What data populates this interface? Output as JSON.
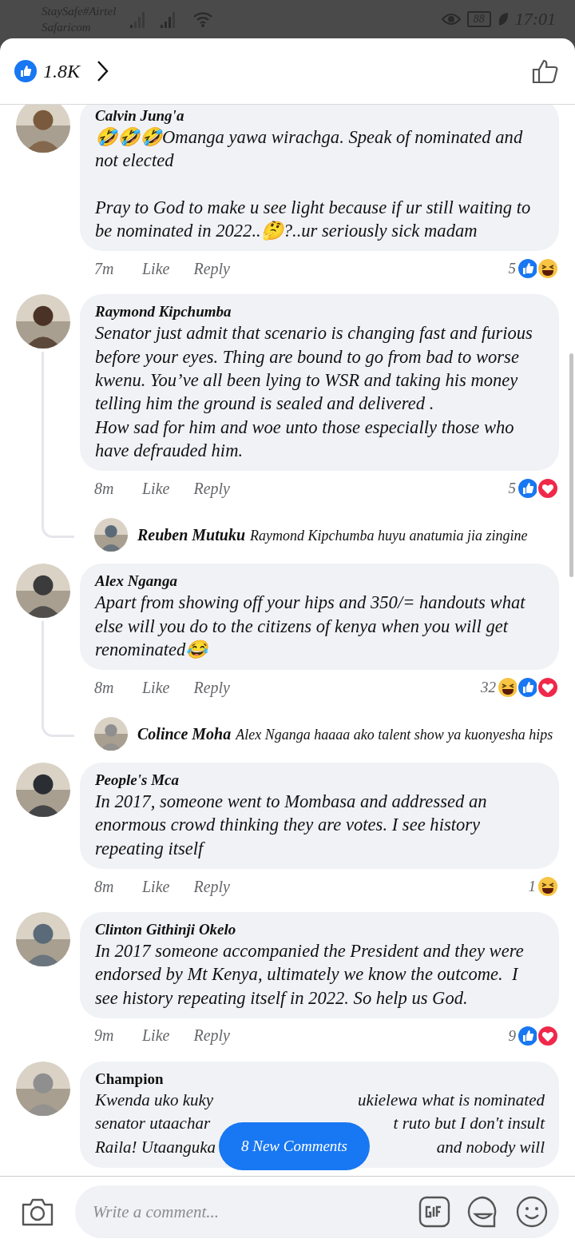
{
  "status_bar": {
    "carrier_1": "StaySafe#Airtel",
    "carrier_2": "Safaricom",
    "battery": "88",
    "time": "17:01"
  },
  "header": {
    "reaction_count": "1.8K"
  },
  "comments": [
    {
      "name": "Calvin Jung'a",
      "text": "🤣🤣🤣Omanga yawa wirachga. Speak of nominated and not elected\n\nPray to God to make u see light because if ur still waiting to be nominated in 2022..🤔?..ur seriously sick madam",
      "time": "7m",
      "like": "Like",
      "reply": "Reply",
      "count": "5",
      "reactions": [
        {
          "kind": "like"
        },
        {
          "kind": "haha"
        }
      ]
    },
    {
      "name": "Raymond Kipchumba",
      "text": "Senator just admit that scenario is changing fast and furious before your eyes. Thing are bound to go from bad to worse kwenu. You’ve all been lying to WSR and taking his money telling him the ground is sealed and delivered .\nHow sad for him and woe unto those especially those who have defrauded him.",
      "time": "8m",
      "like": "Like",
      "reply": "Reply",
      "count": "5",
      "reactions": [
        {
          "kind": "like"
        },
        {
          "kind": "love"
        }
      ],
      "replies": [
        {
          "name": "Reuben Mutuku",
          "text": "Raymond Kipchumba  huyu anatumia jia zingine"
        }
      ]
    },
    {
      "name": "Alex Nganga",
      "text": "Apart from showing off your hips and 350/= handouts what else will you do to the citizens of kenya when you will get renominated😂",
      "time": "8m",
      "like": "Like",
      "reply": "Reply",
      "count": "32",
      "reactions": [
        {
          "kind": "haha"
        },
        {
          "kind": "like"
        },
        {
          "kind": "love"
        }
      ],
      "replies": [
        {
          "name": "Colince Moha",
          "text": "Alex Nganga haaaa ako talent show ya kuonyesha hips"
        }
      ]
    },
    {
      "name": "People's Mca",
      "text": "In 2017, someone went to Mombasa and addressed an enormous crowd thinking they are votes. I see history repeating itself",
      "time": "8m",
      "like": "Like",
      "reply": "Reply",
      "count": "1",
      "reactions": [
        {
          "kind": "haha"
        }
      ]
    },
    {
      "name": "Clinton Githinji Okelo",
      "text": "In 2017 someone accompanied the President and they were endorsed by Mt Kenya, ultimately we know the outcome.  I see history repeating itself in 2022. So help us God.",
      "time": "9m",
      "like": "Like",
      "reply": "Reply",
      "count": "9",
      "reactions": [
        {
          "kind": "like"
        },
        {
          "kind": "love"
        }
      ]
    },
    {
      "name": "Champion",
      "lines": [
        {
          "left": "Kwenda uko kuky",
          "right": "ukielewa what is nominated"
        },
        {
          "left": "senator utaachar",
          "right": "t ruto but I don't insult"
        },
        {
          "left": "Raila! Utaanguka",
          "right": "and nobody will"
        }
      ]
    }
  ],
  "new_comments_button": "8 New Comments",
  "composer": {
    "placeholder": "Write a comment..."
  }
}
